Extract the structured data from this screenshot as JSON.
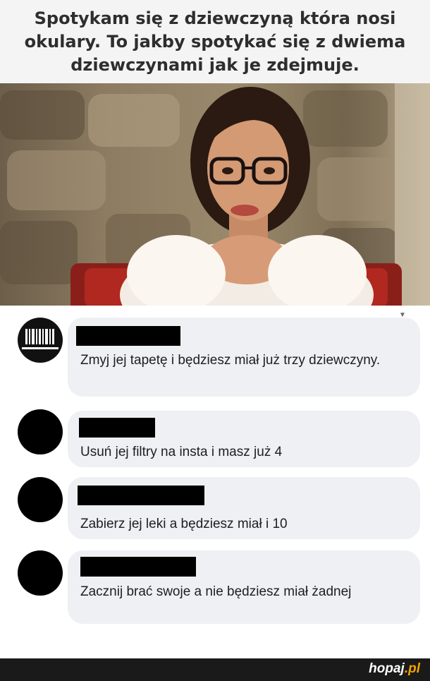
{
  "caption": {
    "text": "Spotykam się z dziewczyną która nosi okulary. To jakby spotykać się z dwiema dziewczynami jak je zdejmuje."
  },
  "photo": {
    "description_icon": "woman-with-glasses-photo"
  },
  "comments": [
    {
      "avatar": "barcode-logo-avatar",
      "text": "Zmyj jej tapetę i będziesz miał już trzy dziewczyny."
    },
    {
      "avatar": "black-circle-avatar",
      "text": "Usuń jej filtry na insta i masz już 4"
    },
    {
      "avatar": "black-circle-avatar",
      "text": "Zabierz jej leki a będziesz miał i 10"
    },
    {
      "avatar": "black-circle-avatar",
      "text": "Zacznij brać swoje a nie będziesz miał żadnej"
    }
  ],
  "footer": {
    "brand_main": "hopaj",
    "brand_tld": ".pl"
  },
  "colors": {
    "caption_bg": "#f4f4f4",
    "bubble_bg": "#eef0f3",
    "footer_bg": "#1a1a1a",
    "brand_accent": "#f2a400"
  }
}
